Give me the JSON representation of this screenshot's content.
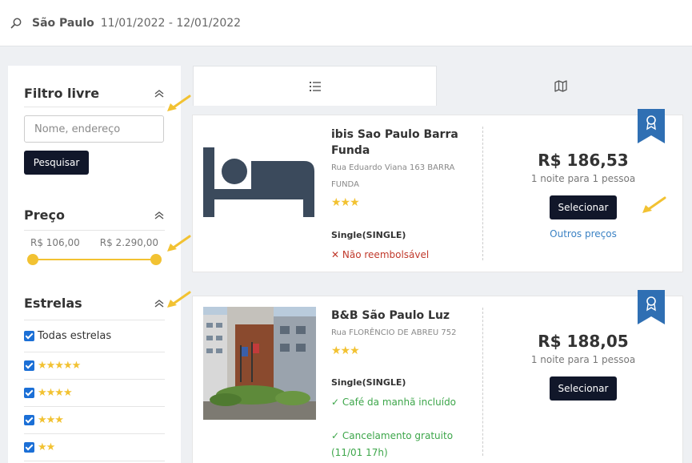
{
  "search": {
    "city": "São Paulo",
    "dates": "11/01/2022 - 12/01/2022"
  },
  "sidebar": {
    "free_filter": {
      "title": "Filtro livre",
      "input_placeholder": "Nome, endereço",
      "button_label": "Pesquisar"
    },
    "price": {
      "title": "Preço",
      "min_label": "R$ 106,00",
      "max_label": "R$ 2.290,00"
    },
    "stars_filter": {
      "title": "Estrelas",
      "all_label": "Todas estrelas",
      "options": [
        {
          "stars": "★★★★★",
          "checked": true
        },
        {
          "stars": "★★★★",
          "checked": true
        },
        {
          "stars": "★★★",
          "checked": true
        },
        {
          "stars": "★★",
          "checked": true
        }
      ]
    }
  },
  "tabs": [
    {
      "icon": "list-icon",
      "active": true
    },
    {
      "icon": "map-icon",
      "active": false
    }
  ],
  "hotels": [
    {
      "name": "ibis Sao Paulo Barra Funda",
      "address": "Rua Eduardo Viana 163 BARRA FUNDA",
      "stars": "★★★",
      "room": "Single(SINGLE)",
      "conditions": [
        {
          "icon": "cross-icon",
          "text": "Não reembolsável"
        }
      ],
      "price": "R$ 186,53",
      "per": "1 noite para 1 pessoa",
      "select_label": "Selecionar",
      "other_prices": "Outros preços"
    },
    {
      "name": "B&B São Paulo Luz",
      "address": "Rua FLORÊNCIO DE ABREU 752",
      "stars": "★★★",
      "room": "Single(SINGLE)",
      "conditions": [
        {
          "icon": "check-icon",
          "text": "Café da manhã incluído"
        },
        {
          "icon": "check-icon",
          "text": "Cancelamento gratuito (11/01 17h)"
        }
      ],
      "price": "R$ 188,05",
      "per": "1 noite para 1 pessoa",
      "select_label": "Selecionar"
    }
  ],
  "colors": {
    "accent_dark": "#11172a",
    "slider_yellow": "#f2c232",
    "ribbon_blue": "#2f6fb3",
    "link_blue": "#3b82c4",
    "refund_red": "#c0392b",
    "benefit_green": "#3da64a"
  }
}
